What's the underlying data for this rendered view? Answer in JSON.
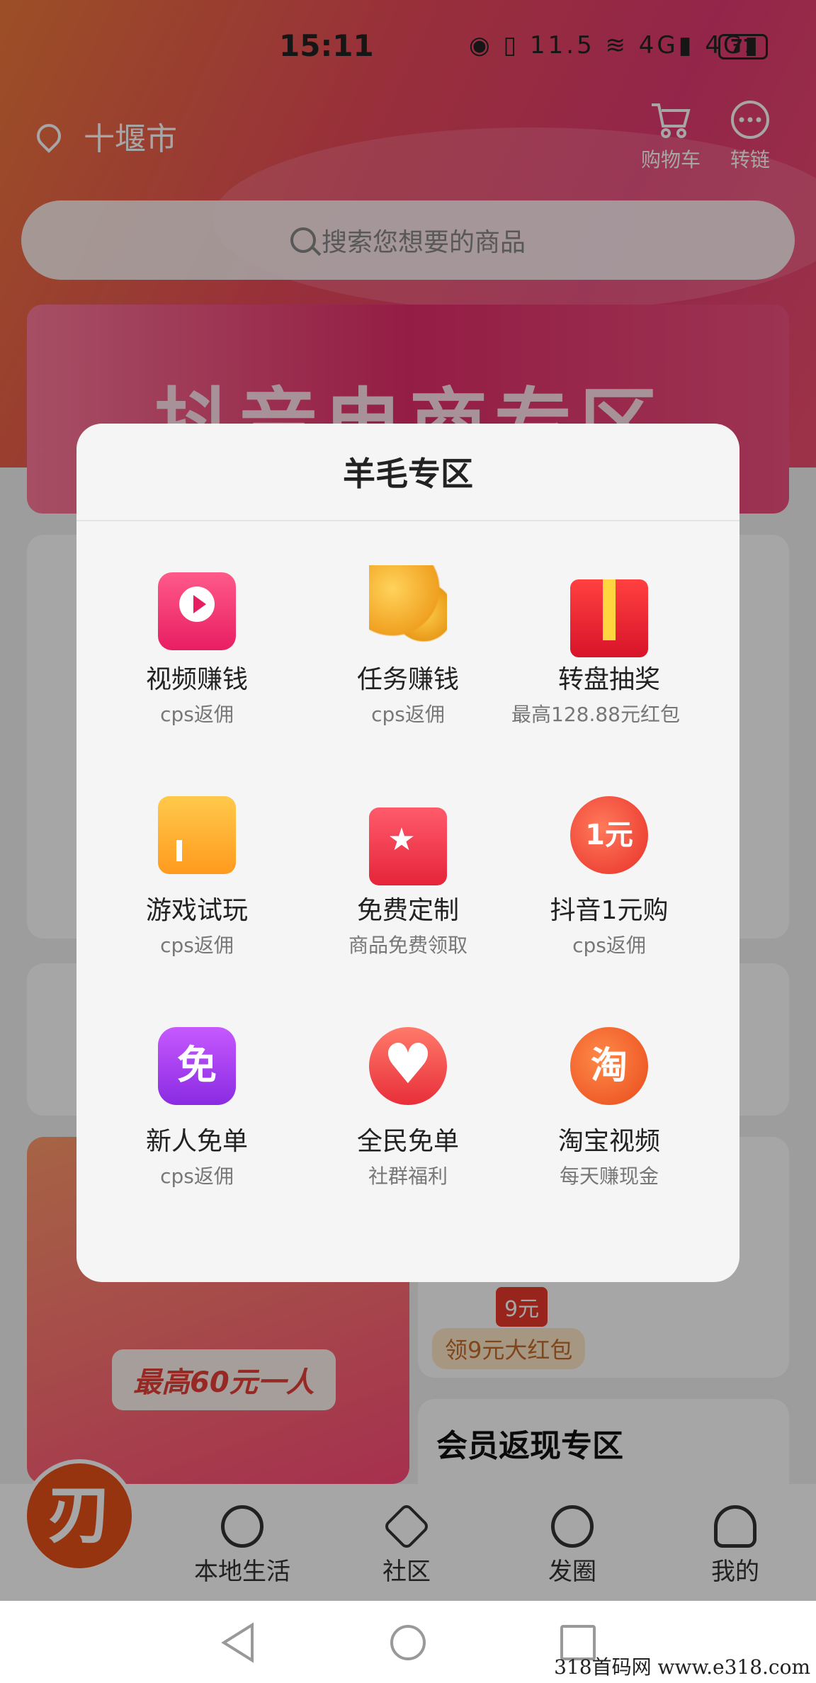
{
  "statusbar": {
    "time": "15:11",
    "icons": "◉ ▯ 11.5 ≋ 4G▮ 4G▮",
    "battery": "77"
  },
  "header": {
    "location": "十堰市",
    "cart_label": "购物车",
    "link_label": "转链"
  },
  "search": {
    "placeholder": "搜索您想要的商品"
  },
  "banner": {
    "title": "抖音电商专区"
  },
  "modal": {
    "title": "羊毛专区",
    "items": [
      {
        "name": "视频赚钱",
        "sub": "cps返佣",
        "icon": "video-tv-icon"
      },
      {
        "name": "任务赚钱",
        "sub": "cps返佣",
        "icon": "gold-coins-icon"
      },
      {
        "name": "转盘抽奖",
        "sub": "最高128.88元红包",
        "icon": "gift-box-icon"
      },
      {
        "name": "游戏试玩",
        "sub": "cps返佣",
        "icon": "shop-icon"
      },
      {
        "name": "免费定制",
        "sub": "商品免费领取",
        "icon": "shopping-bag-icon"
      },
      {
        "name": "抖音1元购",
        "sub": "cps返佣",
        "icon": "one-yuan-icon",
        "glyph": "1元"
      },
      {
        "name": "新人免单",
        "sub": "cps返佣",
        "icon": "free-badge-icon",
        "glyph": "免"
      },
      {
        "name": "全民免单",
        "sub": "社群福利",
        "icon": "heart-icon"
      },
      {
        "name": "淘宝视频",
        "sub": "每天赚现金",
        "icon": "taobao-icon",
        "glyph": "淘"
      }
    ]
  },
  "background": {
    "promo_text": "最高60元一人",
    "red_packet": "领9元大红包",
    "price_tag": "9元",
    "member_title": "会员返现专区"
  },
  "nav": {
    "items": [
      "本地生活",
      "社区",
      "发圈",
      "我的"
    ]
  },
  "watermark": "318首码网 www.e318.com"
}
